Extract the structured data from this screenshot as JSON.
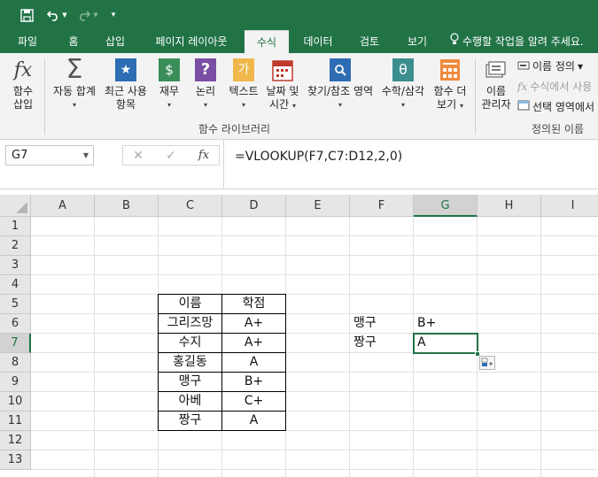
{
  "tabs": [
    {
      "label": "파일"
    },
    {
      "label": "홈"
    },
    {
      "label": "삽입"
    },
    {
      "label": "페이지 레이아웃"
    },
    {
      "label": "수식"
    },
    {
      "label": "데이터"
    },
    {
      "label": "검토"
    },
    {
      "label": "보기"
    }
  ],
  "tell_me": "수행할 작업을 알려 주세요.",
  "ribbon": {
    "insert_function": [
      "함수",
      "삽입"
    ],
    "autosum": "자동 합계",
    "recent": [
      "최근 사용",
      "항목"
    ],
    "financial": "재무",
    "logical": "논리",
    "text": "텍스트",
    "datetime": [
      "날짜 및",
      "시간"
    ],
    "lookup": "찾기/참조 영역",
    "math": "수학/삼각",
    "more": [
      "함수 더",
      "보기"
    ],
    "name_manager": [
      "이름",
      "관리자"
    ],
    "define_name": "이름 정의",
    "use_in_formula": "수식에서 사용",
    "create_from_selection": "선택 영역에서",
    "group_library": "함수 라이브러리",
    "group_defined": "정의된 이름",
    "icon_glyphs": {
      "financial": "$",
      "logical": "?",
      "text": "가",
      "lookup": "🔍",
      "math": "θ",
      "fx": "fx",
      "sigma": "Σ",
      "star": "★"
    }
  },
  "name_box": "G7",
  "formula": "=VLOOKUP(F7,C7:D12,2,0)",
  "columns": [
    "A",
    "B",
    "C",
    "D",
    "E",
    "F",
    "G",
    "H",
    "I"
  ],
  "rows": [
    "1",
    "2",
    "3",
    "4",
    "5",
    "6",
    "7",
    "8",
    "9",
    "10",
    "11",
    "12",
    "13"
  ],
  "table": {
    "header": [
      "이름",
      "학점"
    ],
    "rows": [
      [
        "그리즈망",
        "A+"
      ],
      [
        "수지",
        "A+"
      ],
      [
        "홍길동",
        "A"
      ],
      [
        "맹구",
        "B+"
      ],
      [
        "아베",
        "C+"
      ],
      [
        "짱구",
        "A"
      ]
    ]
  },
  "lookup": [
    {
      "name": "맹구",
      "value": "B+"
    },
    {
      "name": "짱구",
      "value": "A"
    }
  ],
  "colors": {
    "accent": "#217346"
  }
}
